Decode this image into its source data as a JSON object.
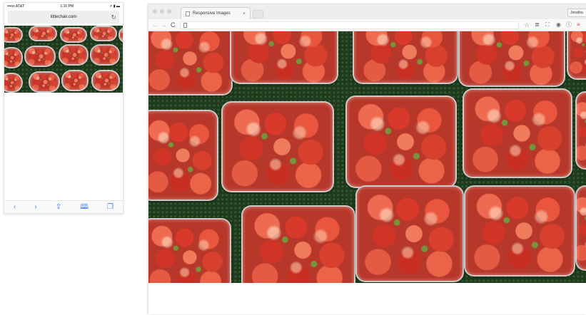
{
  "phone": {
    "status": {
      "carrier": "•••oo AT&T",
      "time": "1:10 PM",
      "battery": "⇗ ▮ ▬"
    },
    "address": "littlechair.com",
    "reload_icon": "↻",
    "toolbar": {
      "back": "‹",
      "forward": "›",
      "share": "⇪",
      "bookmarks": "🕮",
      "tabs": "❐"
    }
  },
  "browser": {
    "tab_title": "Responsive Images",
    "tab_close": "×",
    "profile": "Jonatha",
    "nav": {
      "back": "←",
      "forward": "→",
      "reload": "C"
    },
    "toolbar_icons": {
      "star": "☆",
      "layers": "≣",
      "tag": "⛶",
      "shield": "◉",
      "info": "ⓘ",
      "menu": "≡"
    }
  }
}
